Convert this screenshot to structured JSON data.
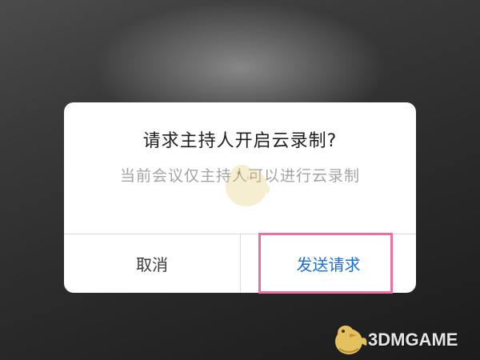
{
  "dialog": {
    "title": "请求主持人开启云录制?",
    "body": "当前会议仅主持人可以进行云录制",
    "cancel_label": "取消",
    "confirm_label": "发送请求"
  },
  "watermark": {
    "logo_text": "3DMGAME"
  },
  "colors": {
    "confirm_text": "#1e6fd1",
    "highlight_border": "#ec6fa2",
    "dialog_background": "#ffffff"
  }
}
